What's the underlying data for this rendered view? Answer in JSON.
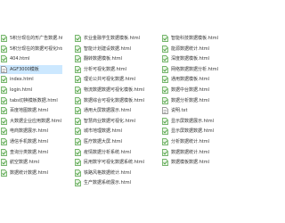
{
  "columns": [
    {
      "items": [
        {
          "label": "5积分现在的形广告数据.html",
          "icon": "html-file-icon"
        },
        {
          "label": "5积分现在的数据可视化html",
          "icon": "html-file-icon"
        },
        {
          "label": "404.html",
          "icon": "html-file-icon"
        },
        {
          "label": "AGF3000模板",
          "icon": "text-file-icon",
          "selected": true
        },
        {
          "label": "index.html",
          "icon": "html-file-icon"
        },
        {
          "label": "login.html",
          "icon": "html-file-icon"
        },
        {
          "label": "tabs切换模板数据.html",
          "icon": "html-file-icon"
        },
        {
          "label": "百度地图数据.html",
          "icon": "html-file-icon"
        },
        {
          "label": "大数据企业应用数据.html",
          "icon": "html-file-icon"
        },
        {
          "label": "电商数据展示.html",
          "icon": "html-file-icon"
        },
        {
          "label": "通信手机数据.html",
          "icon": "html-file-icon"
        },
        {
          "label": "查询分类数据.html",
          "icon": "html-file-icon"
        },
        {
          "label": "航空数据.html",
          "icon": "html-file-icon"
        },
        {
          "label": "数据统计数据.html",
          "icon": "html-file-icon"
        }
      ]
    },
    {
      "items": [
        {
          "label": "农业金融学生数据模板.html",
          "icon": "html-file-icon"
        },
        {
          "label": "智能计划建设数据.html",
          "icon": "html-file-icon"
        },
        {
          "label": "翻转数据模板.html",
          "icon": "html-file-icon"
        },
        {
          "label": "分析可视化数据.html",
          "icon": "html-file-icon"
        },
        {
          "label": "理论公共可视化数据.html",
          "icon": "html-file-icon"
        },
        {
          "label": "物流数据数据可视化模板.html",
          "icon": "html-file-icon"
        },
        {
          "label": "数据综合可视化数据模板.html",
          "icon": "html-file-icon"
        },
        {
          "label": "通用大屏数据展示.html",
          "icon": "html-file-icon"
        },
        {
          "label": "智慧商业数据可视化.html",
          "icon": "html-file-icon"
        },
        {
          "label": "城市地理数据.html",
          "icon": "html-file-icon"
        },
        {
          "label": "医疗数据大屏.html",
          "icon": "html-file-icon"
        },
        {
          "label": "疫情数据分析系统.html",
          "icon": "html-file-icon"
        },
        {
          "label": "民用数字可视化数据系统.html",
          "icon": "html-file-icon"
        },
        {
          "label": "铁路风格数据统计.html",
          "icon": "html-file-icon"
        },
        {
          "label": "生产数据系统展示.html",
          "icon": "html-file-icon"
        }
      ]
    },
    {
      "items": [
        {
          "label": "智能科技数据模板.html",
          "icon": "html-file-icon"
        },
        {
          "label": "能源数据统计.html",
          "icon": "html-file-icon"
        },
        {
          "label": "深度数据模板.html",
          "icon": "html-file-icon"
        },
        {
          "label": "网络数据数据分析.html",
          "icon": "html-file-icon"
        },
        {
          "label": "通用数据模板.html",
          "icon": "html-file-icon"
        },
        {
          "label": "数据中台数据.html",
          "icon": "html-file-icon"
        },
        {
          "label": "数据分析数据.html",
          "icon": "html-file-icon"
        },
        {
          "label": "说明.txt",
          "icon": "text-file-icon"
        },
        {
          "label": "显示屏数据展示.html",
          "icon": "html-file-icon"
        },
        {
          "label": "显示屏数据数据.html",
          "icon": "html-file-icon"
        },
        {
          "label": "分析数据统计.html",
          "icon": "html-file-icon"
        },
        {
          "label": "数据数据统计.html",
          "icon": "html-file-icon"
        },
        {
          "label": "数据模板数据.html",
          "icon": "html-file-icon"
        }
      ]
    }
  ],
  "colors": {
    "text": "#333333",
    "selection": "#cce8ff",
    "html_icon": "#4a9e3f",
    "html_icon_page": "#e8f4e4",
    "text_icon": "#7a7a7a"
  }
}
